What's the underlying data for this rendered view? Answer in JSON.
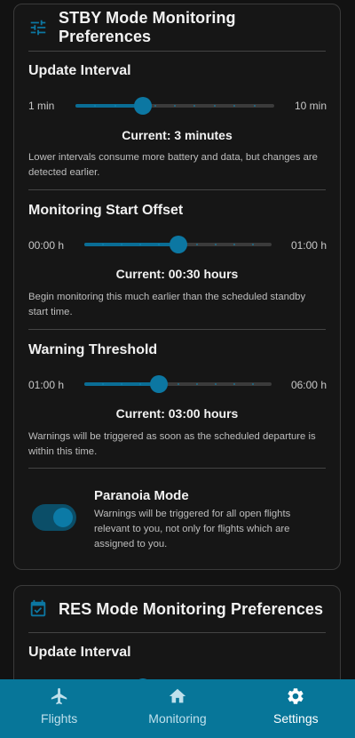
{
  "colors": {
    "accent": "#0c77a2",
    "background": "#121212",
    "card": "#161616",
    "nav": "#077699"
  },
  "stby": {
    "title": "STBY Mode Monitoring Preferences",
    "icon": "sliders-icon",
    "update_interval": {
      "title": "Update Interval",
      "min": "1 min",
      "max": "10 min",
      "value_fraction": 0.34,
      "current": "Current: 3 minutes",
      "description": "Lower intervals consume more battery and data, but changes are detected earlier."
    },
    "start_offset": {
      "title": "Monitoring Start Offset",
      "min": "00:00 h",
      "max": "01:00 h",
      "value_fraction": 0.5,
      "current": "Current: 00:30 hours",
      "description": "Begin monitoring this much earlier than the scheduled standby start time."
    },
    "warning_threshold": {
      "title": "Warning Threshold",
      "min": "01:00 h",
      "max": "06:00 h",
      "value_fraction": 0.4,
      "current": "Current: 03:00 hours",
      "description": "Warnings will be triggered as soon as the scheduled departure is within this time."
    },
    "paranoia": {
      "title": "Paranoia Mode",
      "enabled": true,
      "description": "Warnings will be triggered for all open flights relevant to you, not only for flights which are assigned to you."
    }
  },
  "res": {
    "title": "RES Mode Monitoring Preferences",
    "icon": "calendar-check-icon",
    "update_interval": {
      "title": "Update Interval"
    }
  },
  "nav": [
    {
      "label": "Flights",
      "icon": "airplane-icon",
      "active": false
    },
    {
      "label": "Monitoring",
      "icon": "home-icon",
      "active": false
    },
    {
      "label": "Settings",
      "icon": "gear-icon",
      "active": true
    }
  ]
}
